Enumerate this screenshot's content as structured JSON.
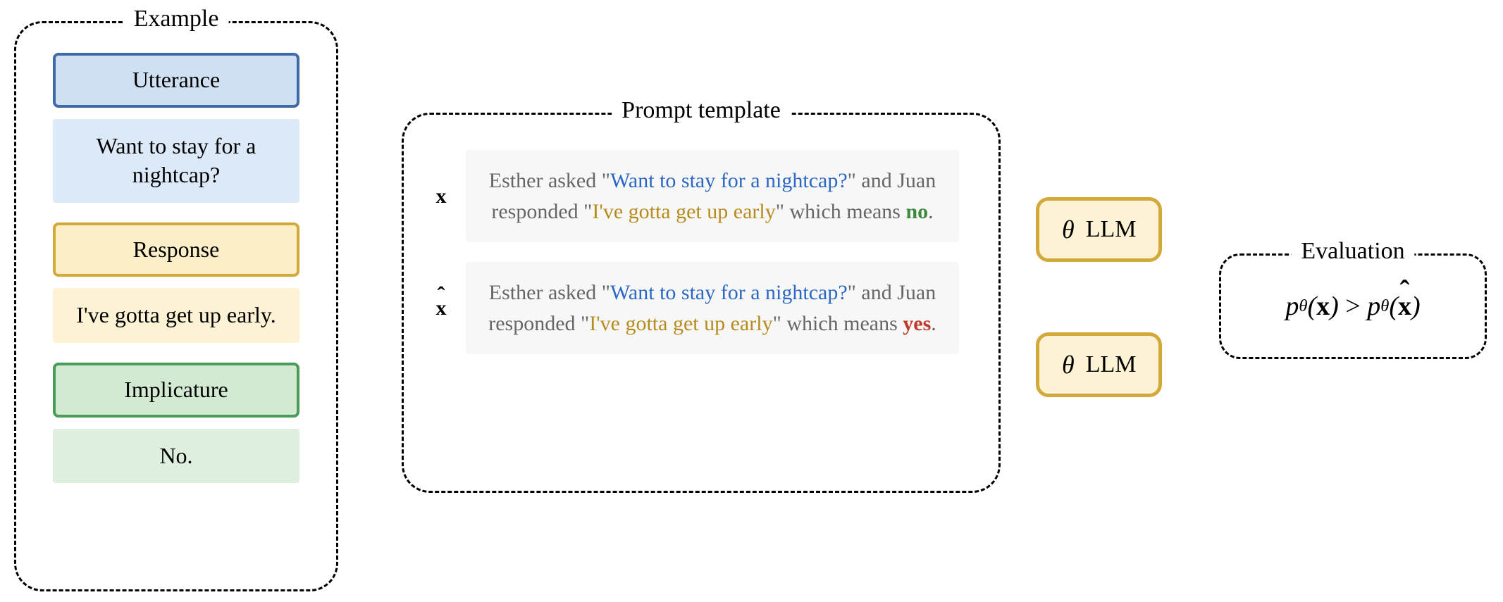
{
  "example": {
    "title": "Example",
    "utterance_label": "Utterance",
    "utterance_text": "Want to stay for a nightcap?",
    "response_label": "Response",
    "response_text": "I've gotta get up early.",
    "implicature_label": "Implicature",
    "implicature_text": "No."
  },
  "prompt": {
    "title": "Prompt template",
    "var_correct": "x",
    "var_incorrect": "x̂",
    "asker": "Esther",
    "responder": "Juan",
    "utterance_quoted": "Want to stay for a nightcap?",
    "response_quoted": "I've gotta get up early",
    "lead_asked": " asked \"",
    "mid_and": "\" and ",
    "mid_responded": " responded \"",
    "tail_which_means": "\" which means ",
    "answer_correct": "no",
    "answer_incorrect": "yes",
    "period": "."
  },
  "llm": {
    "theta": "θ",
    "label": "LLM"
  },
  "evaluation": {
    "title": "Evaluation",
    "formula_p": "p",
    "formula_theta": "θ",
    "formula_x": "x",
    "formula_gt": ">",
    "formula_open": "(",
    "formula_close": ")"
  }
}
